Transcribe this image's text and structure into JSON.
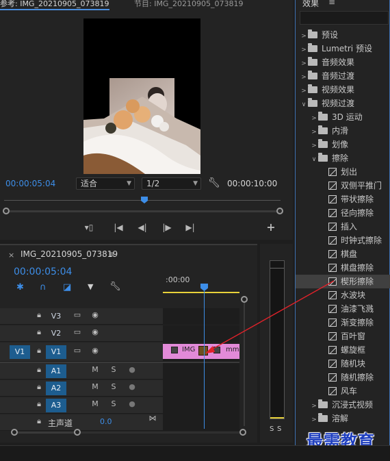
{
  "program": {
    "tab1": "参考: IMG_20210905_073819",
    "tab1_menu": "≡",
    "tab2": "节目: IMG_20210905_073819",
    "current_timecode": "00:00:05:04",
    "fit_select": "适合",
    "resolution_select": "1/2",
    "duration_timecode": "00:00:10:00"
  },
  "timeline": {
    "sequence_name": "IMG_20210905_073819",
    "menu": "≡",
    "timecode": "00:00:05:04",
    "ruler_label": ":00:00",
    "video_tracks": [
      {
        "source": "",
        "name": "V3",
        "toggle": "▭",
        "eye": "◉"
      },
      {
        "source": "",
        "name": "V2",
        "toggle": "▭",
        "eye": "◉"
      },
      {
        "source": "V1",
        "name": "V1",
        "toggle": "▭",
        "eye": "◉"
      }
    ],
    "audio_tracks": [
      {
        "name": "A1",
        "m": "M",
        "s": "S"
      },
      {
        "name": "A2",
        "m": "M",
        "s": "S"
      },
      {
        "name": "A3",
        "m": "M",
        "s": "S"
      }
    ],
    "master": {
      "label": "主声道",
      "value": "0.0"
    },
    "clip1": "IMG",
    "clip2": "mm",
    "clip_color": "#e28ad8"
  },
  "meter": {
    "s1": "S",
    "s2": "S"
  },
  "effects": {
    "title": "效果",
    "menu": "≡",
    "items": [
      {
        "label": "预设",
        "kind": "folder",
        "level": 0,
        "expanded": false,
        "special": true
      },
      {
        "label": "Lumetri 预设",
        "kind": "folder",
        "level": 0,
        "expanded": false,
        "special": true
      },
      {
        "label": "音频效果",
        "kind": "folder",
        "level": 0,
        "expanded": false
      },
      {
        "label": "音频过渡",
        "kind": "folder",
        "level": 0,
        "expanded": false
      },
      {
        "label": "视频效果",
        "kind": "folder",
        "level": 0,
        "expanded": false
      },
      {
        "label": "视频过渡",
        "kind": "folder",
        "level": 0,
        "expanded": true
      },
      {
        "label": "3D 运动",
        "kind": "folder",
        "level": 1,
        "expanded": false
      },
      {
        "label": "内滑",
        "kind": "folder",
        "level": 1,
        "expanded": false
      },
      {
        "label": "划像",
        "kind": "folder",
        "level": 1,
        "expanded": false
      },
      {
        "label": "擦除",
        "kind": "folder",
        "level": 1,
        "expanded": true
      },
      {
        "label": "划出",
        "kind": "effect",
        "level": 2
      },
      {
        "label": "双侧平推门",
        "kind": "effect",
        "level": 2
      },
      {
        "label": "带状擦除",
        "kind": "effect",
        "level": 2
      },
      {
        "label": "径向擦除",
        "kind": "effect",
        "level": 2
      },
      {
        "label": "插入",
        "kind": "effect",
        "level": 2
      },
      {
        "label": "时钟式擦除",
        "kind": "effect",
        "level": 2
      },
      {
        "label": "棋盘",
        "kind": "effect",
        "level": 2
      },
      {
        "label": "棋盘擦除",
        "kind": "effect",
        "level": 2
      },
      {
        "label": "楔形擦除",
        "kind": "effect",
        "level": 2,
        "selected": true
      },
      {
        "label": "水波块",
        "kind": "effect",
        "level": 2
      },
      {
        "label": "油漆飞溅",
        "kind": "effect",
        "level": 2
      },
      {
        "label": "渐变擦除",
        "kind": "effect",
        "level": 2
      },
      {
        "label": "百叶窗",
        "kind": "effect",
        "level": 2
      },
      {
        "label": "螺旋框",
        "kind": "effect",
        "level": 2
      },
      {
        "label": "随机块",
        "kind": "effect",
        "level": 2
      },
      {
        "label": "随机擦除",
        "kind": "effect",
        "level": 2
      },
      {
        "label": "风车",
        "kind": "effect",
        "level": 2
      },
      {
        "label": "沉浸式视频",
        "kind": "folder",
        "level": 1,
        "expanded": false
      },
      {
        "label": "溶解",
        "kind": "folder",
        "level": 1,
        "expanded": false
      }
    ]
  },
  "watermark": "最需教育",
  "colors": {
    "accent": "#3d8ee8",
    "arrow": "#e0222a",
    "playhead": "#3d8ee8",
    "work_area": "#e8d23a"
  }
}
